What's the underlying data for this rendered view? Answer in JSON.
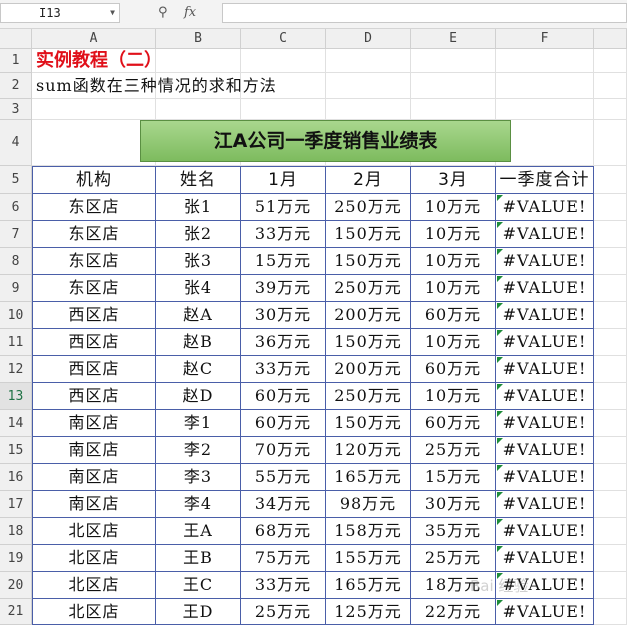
{
  "formula_bar": {
    "name_box": "I13",
    "fx": "fx",
    "zoom_icon": "magnifier-icon",
    "formula": ""
  },
  "columns": [
    "A",
    "B",
    "C",
    "D",
    "E",
    "F"
  ],
  "rows": [
    "1",
    "2",
    "3",
    "4",
    "5",
    "6",
    "7",
    "8",
    "9",
    "10",
    "11",
    "12",
    "13",
    "14",
    "15",
    "16",
    "17",
    "18",
    "19",
    "20",
    "21"
  ],
  "active_row": "13",
  "sheet": {
    "title": "实例教程（二）",
    "subtitle": "sum函数在三种情况的求和方法",
    "banner": "江A公司一季度销售业绩表",
    "headers": [
      "机构",
      "姓名",
      "1月",
      "2月",
      "3月",
      "一季度合计"
    ],
    "data": [
      [
        "东区店",
        "张1",
        "51万元",
        "250万元",
        "10万元",
        "#VALUE!"
      ],
      [
        "东区店",
        "张2",
        "33万元",
        "150万元",
        "10万元",
        "#VALUE!"
      ],
      [
        "东区店",
        "张3",
        "15万元",
        "150万元",
        "10万元",
        "#VALUE!"
      ],
      [
        "东区店",
        "张4",
        "39万元",
        "250万元",
        "10万元",
        "#VALUE!"
      ],
      [
        "西区店",
        "赵A",
        "30万元",
        "200万元",
        "60万元",
        "#VALUE!"
      ],
      [
        "西区店",
        "赵B",
        "36万元",
        "150万元",
        "10万元",
        "#VALUE!"
      ],
      [
        "西区店",
        "赵C",
        "33万元",
        "200万元",
        "60万元",
        "#VALUE!"
      ],
      [
        "西区店",
        "赵D",
        "60万元",
        "250万元",
        "10万元",
        "#VALUE!"
      ],
      [
        "南区店",
        "李1",
        "60万元",
        "150万元",
        "60万元",
        "#VALUE!"
      ],
      [
        "南区店",
        "李2",
        "70万元",
        "120万元",
        "25万元",
        "#VALUE!"
      ],
      [
        "南区店",
        "李3",
        "55万元",
        "165万元",
        "15万元",
        "#VALUE!"
      ],
      [
        "南区店",
        "李4",
        "34万元",
        "98万元",
        "30万元",
        "#VALUE!"
      ],
      [
        "北区店",
        "王A",
        "68万元",
        "158万元",
        "35万元",
        "#VALUE!"
      ],
      [
        "北区店",
        "王B",
        "75万元",
        "155万元",
        "25万元",
        "#VALUE!"
      ],
      [
        "北区店",
        "王C",
        "33万元",
        "165万元",
        "18万元",
        "#VALUE!"
      ],
      [
        "北区店",
        "王D",
        "25万元",
        "125万元",
        "22万元",
        "#VALUE!"
      ]
    ]
  },
  "colors": {
    "title_red": "#e0101a",
    "table_border": "#4a5ea8",
    "banner_green": "#8cc56d",
    "error_triangle": "#1e8c3a"
  }
}
